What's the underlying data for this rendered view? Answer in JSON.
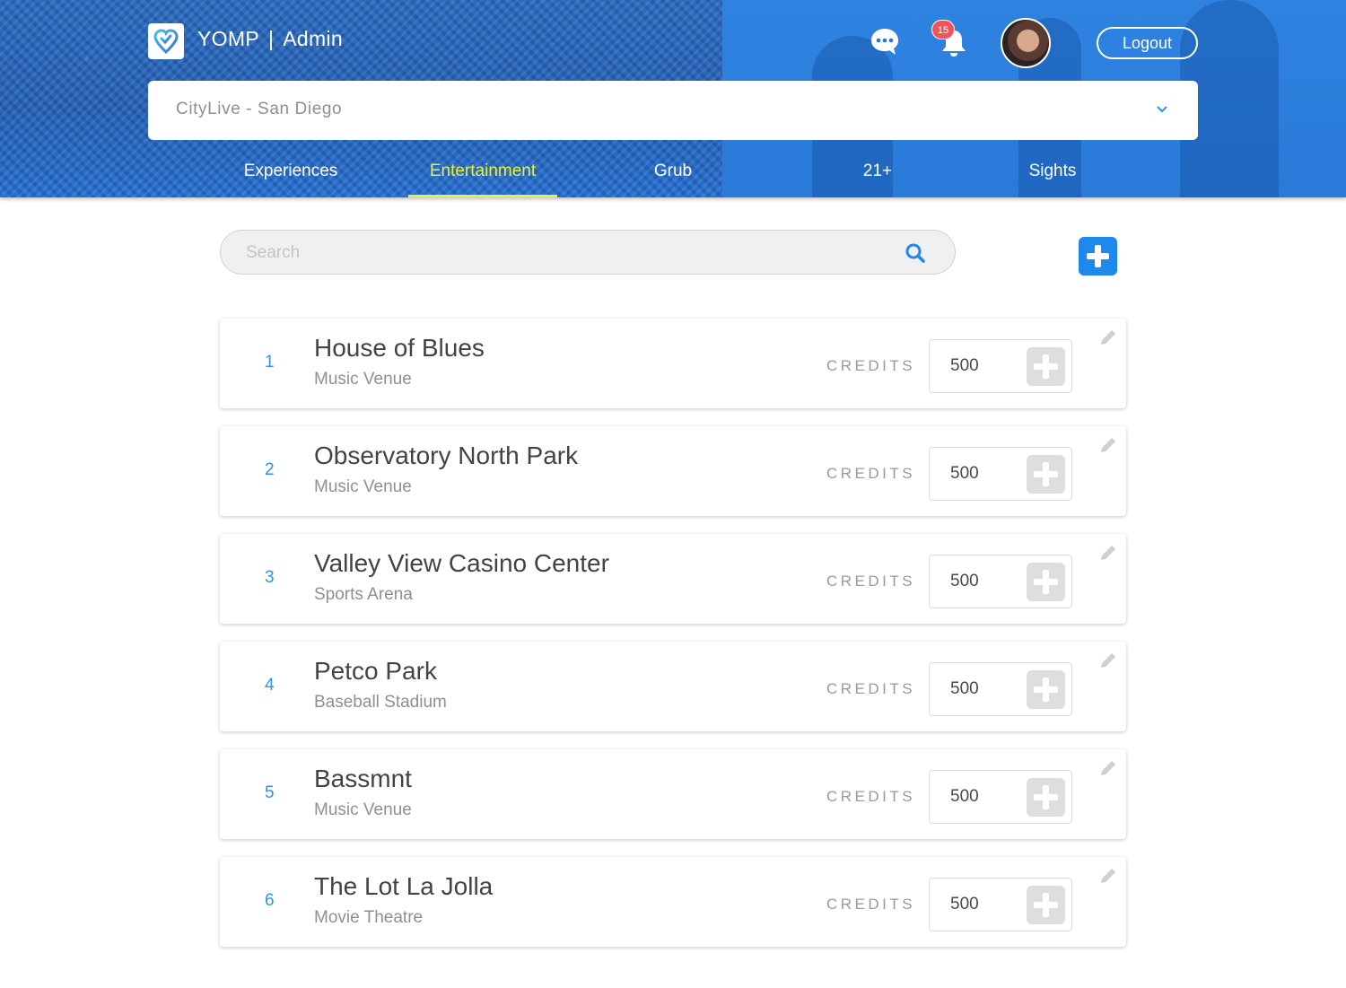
{
  "brand": {
    "name": "YOMP",
    "separator": "|",
    "section": "Admin"
  },
  "header": {
    "notification_count": "15",
    "logout_label": "Logout",
    "city_selected": "CityLive - San Diego"
  },
  "tabs": [
    {
      "label": "Experiences",
      "active": false
    },
    {
      "label": "Entertainment",
      "active": true
    },
    {
      "label": "Grub",
      "active": false
    },
    {
      "label": "21+",
      "active": false
    },
    {
      "label": "Sights",
      "active": false
    }
  ],
  "search": {
    "placeholder": "Search",
    "value": ""
  },
  "list": {
    "credits_label": "CREDITS",
    "items": [
      {
        "index": "1",
        "name": "House of Blues",
        "type": "Music Venue",
        "credits": "500"
      },
      {
        "index": "2",
        "name": "Observatory North Park",
        "type": "Music Venue",
        "credits": "500"
      },
      {
        "index": "3",
        "name": "Valley View Casino Center",
        "type": "Sports Arena",
        "credits": "500"
      },
      {
        "index": "4",
        "name": "Petco Park",
        "type": "Baseball Stadium",
        "credits": "500"
      },
      {
        "index": "5",
        "name": "Bassmnt",
        "type": "Music Venue",
        "credits": "500"
      },
      {
        "index": "6",
        "name": "The Lot La Jolla",
        "type": "Movie Theatre",
        "credits": "500"
      }
    ]
  },
  "colors": {
    "header_blue": "#2a7ad8",
    "active_tab": "#e9f03a",
    "accent_blue": "#1e88ec",
    "index_blue": "#2d94e8",
    "badge_red": "#f2545b"
  },
  "icons": [
    "logo-heart-pin-icon",
    "chat-bubble-icon",
    "bell-icon",
    "chevron-down-icon",
    "search-icon",
    "plus-icon",
    "pencil-icon"
  ]
}
